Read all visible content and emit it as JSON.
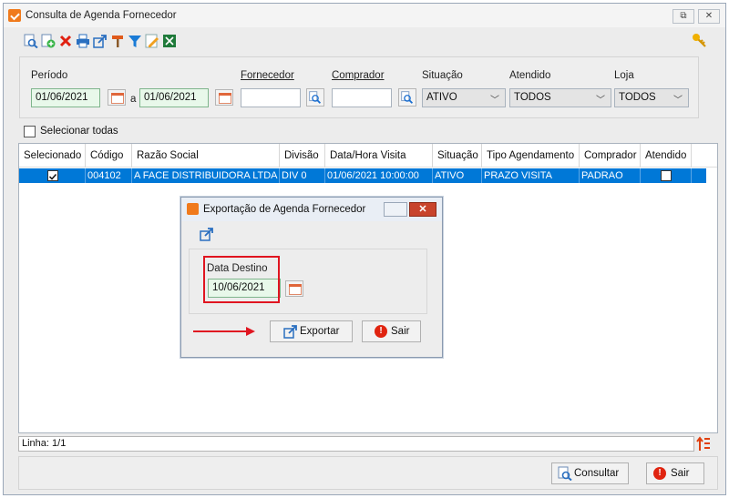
{
  "window": {
    "title": "Consulta de Agenda Fornecedor"
  },
  "titlebar_buttons": {
    "restore": "⧉",
    "close": "✕"
  },
  "toolbar": {
    "icons": [
      "search-icon",
      "add-icon",
      "delete-icon",
      "print-icon",
      "export-icon",
      "hammer-icon",
      "filter-icon",
      "edit-icon",
      "excel-icon"
    ]
  },
  "filters": {
    "periodo_label": "Período",
    "date_from": "01/06/2021",
    "a_label": "a",
    "date_to": "01/06/2021",
    "fornecedor_label": "Fornecedor",
    "fornecedor_value": "",
    "comprador_label": "Comprador",
    "comprador_value": "",
    "situacao_label": "Situação",
    "situacao_value": "ATIVO",
    "atendido_label": "Atendido",
    "atendido_value": "TODOS",
    "loja_label": "Loja",
    "loja_value": "TODOS"
  },
  "select_all": {
    "label": "Selecionar todas",
    "checked": false
  },
  "grid": {
    "columns": [
      "Selecionado",
      "Código",
      "Razão Social",
      "Divisão",
      "Data/Hora Visita",
      "Situação",
      "Tipo Agendamento",
      "Comprador",
      "Atendido"
    ],
    "rows": [
      {
        "selecionado": true,
        "codigo": "004102",
        "razao_social": "A FACE DISTRIBUIDORA LTDA",
        "divisao": "DIV 0",
        "data_hora": "01/06/2021 10:00:00",
        "situacao": "ATIVO",
        "tipo": "PRAZO VISITA",
        "comprador": "PADRAO",
        "atendido": false
      }
    ]
  },
  "dialog": {
    "title": "Exportação de Agenda Fornecedor",
    "data_destino_label": "Data Destino",
    "data_destino_value": "10/06/2021",
    "exportar_label": "Exportar",
    "sair_label": "Sair"
  },
  "status": {
    "linha": "Linha: 1/1"
  },
  "bottom": {
    "consultar_label": "Consultar",
    "sair_label": "Sair"
  },
  "colors": {
    "accent": "#0078d7",
    "orange": "#f07a1c",
    "highlight": "#e01520"
  }
}
